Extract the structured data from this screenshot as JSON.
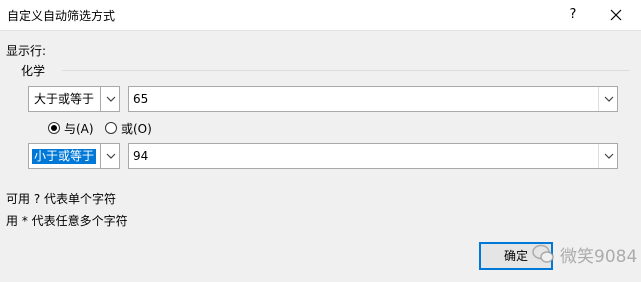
{
  "window": {
    "title": "自定义自动筛选方式",
    "help_label": "?",
    "close_icon": "close-icon"
  },
  "dialog": {
    "show_rows_label": "显示行:",
    "field_name": "化学"
  },
  "condition1": {
    "operator": "大于或等于",
    "value": "65"
  },
  "logic": {
    "and_label": "与(A)",
    "or_label": "或(O)",
    "selected": "and"
  },
  "condition2": {
    "operator": "小于或等于",
    "value": "94"
  },
  "hints": {
    "hint1": "可用 ? 代表单个字符",
    "hint2": "用 * 代表任意多个字符"
  },
  "buttons": {
    "ok_label": "确定"
  },
  "watermark": {
    "text": "微笑9084"
  },
  "colors": {
    "accent": "#0078d7",
    "background": "#f0f0f0"
  }
}
